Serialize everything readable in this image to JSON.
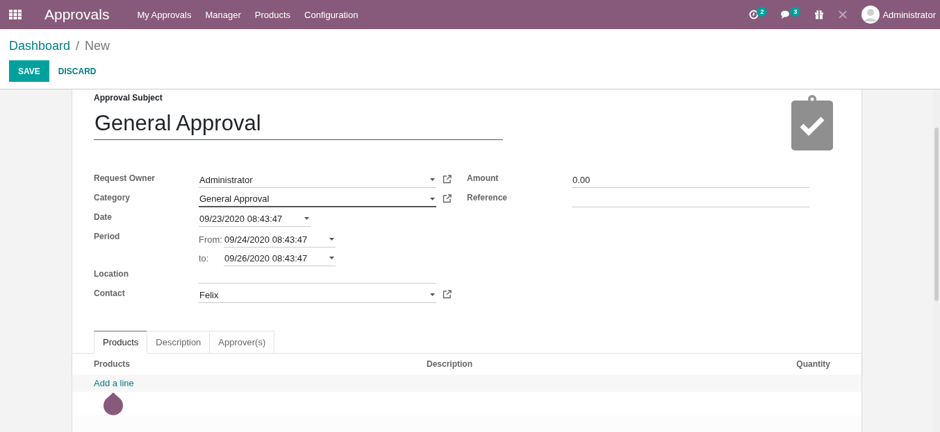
{
  "navbar": {
    "app_title": "Approvals",
    "menus": [
      "My Approvals",
      "Manager",
      "Products",
      "Configuration"
    ],
    "activity_count": "2",
    "message_count": "3",
    "user": "Administrator"
  },
  "breadcrumb": {
    "parent": "Dashboard",
    "separator": "/",
    "current": "New"
  },
  "buttons": {
    "save": "SAVE",
    "discard": "DISCARD"
  },
  "form": {
    "subject_label": "Approval Subject",
    "subject_value": "General Approval",
    "left_fields": [
      {
        "kind": "many2one",
        "label": "Request Owner",
        "value": "Administrator",
        "focused": false
      },
      {
        "kind": "many2one",
        "label": "Category",
        "value": "General Approval",
        "focused": true
      },
      {
        "kind": "date",
        "label": "Date",
        "value": "09/23/2020 08:43:47"
      },
      {
        "kind": "range",
        "label": "Period",
        "from_label": "From:",
        "from_value": "09/24/2020 08:43:47",
        "to_label": "to:",
        "to_value": "09/26/2020 08:43:47"
      },
      {
        "kind": "char",
        "label": "Location"
      },
      {
        "kind": "many2one",
        "label": "Contact",
        "value": "Felix",
        "focused": false
      }
    ],
    "right_fields": [
      {
        "label": "Amount",
        "value": "0.00"
      },
      {
        "label": "Reference"
      }
    ]
  },
  "tabs": [
    {
      "label": "Products",
      "selected": true
    },
    {
      "label": "Description",
      "selected": false
    },
    {
      "label": "Approver(s)",
      "selected": false
    }
  ],
  "table": {
    "columns": [
      "Products",
      "Description",
      "Quantity"
    ],
    "add_line": "Add a line"
  }
}
